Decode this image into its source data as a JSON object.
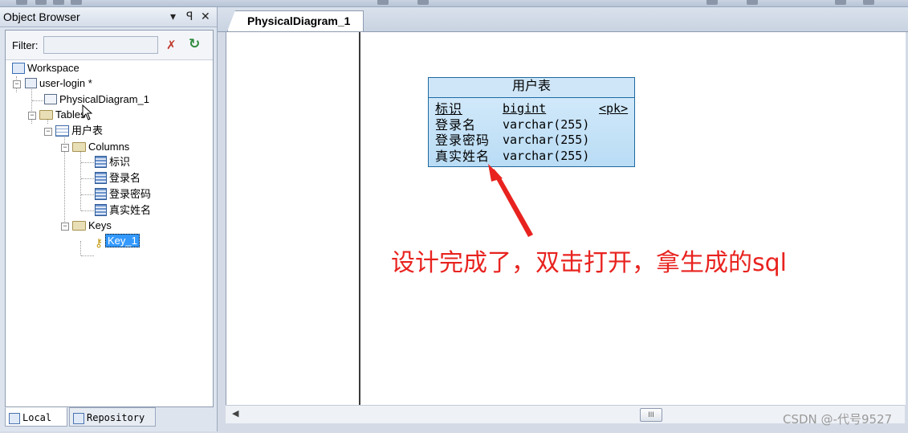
{
  "object_browser": {
    "title": "Object Browser",
    "controls": [
      "▾",
      "ꟼ",
      "✕"
    ],
    "filter_label": "Filter:",
    "filter_value": "",
    "tree": {
      "workspace": "Workspace",
      "model": "user-login *",
      "diagram": "PhysicalDiagram_1",
      "tables_folder": "Tables",
      "table": "用户表",
      "columns_folder": "Columns",
      "columns": [
        "标识",
        "登录名",
        "登录密码",
        "真实姓名"
      ],
      "keys_folder": "Keys",
      "key": "Key_1"
    },
    "tabs": {
      "local": "Local",
      "repository": "Repository"
    }
  },
  "document": {
    "tab_label": "PhysicalDiagram_1"
  },
  "entity": {
    "name": "用户表",
    "rows": [
      {
        "name": "标识",
        "type": "bigint",
        "key": "<pk>"
      },
      {
        "name": "登录名",
        "type": "varchar(255)",
        "key": ""
      },
      {
        "name": "登录密码",
        "type": "varchar(255)",
        "key": ""
      },
      {
        "name": "真实姓名",
        "type": "varchar(255)",
        "key": ""
      }
    ]
  },
  "annotation": {
    "text": "设计完成了，双击打开，拿生成的sql",
    "color": "#e8231f"
  },
  "scrollbar": {
    "thumb_label": "III"
  },
  "watermark": "CSDN @-代号9527"
}
